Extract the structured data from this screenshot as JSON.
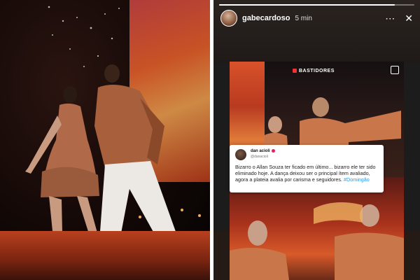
{
  "story": {
    "username": "gabecardoso",
    "time_ago": "5 min",
    "progress_fraction": 0.9,
    "icons": [
      "more-icon",
      "close-icon"
    ]
  },
  "post": {
    "tag_label": "BASTIDORES"
  },
  "tweet": {
    "name": "dan acioli",
    "handle": "@danacioli",
    "text": "Bizarro o Allan Souza ter ficado em último... bizarro ele ter sido eliminado hoje. A dança deixou ser o principal ítem avaliado, agora a plateia avalia por carisma e seguidores.",
    "hashtag": "#Domingão"
  },
  "colors": {
    "accent_verified": "#e0245e",
    "hashtag": "#1d9bf0"
  }
}
